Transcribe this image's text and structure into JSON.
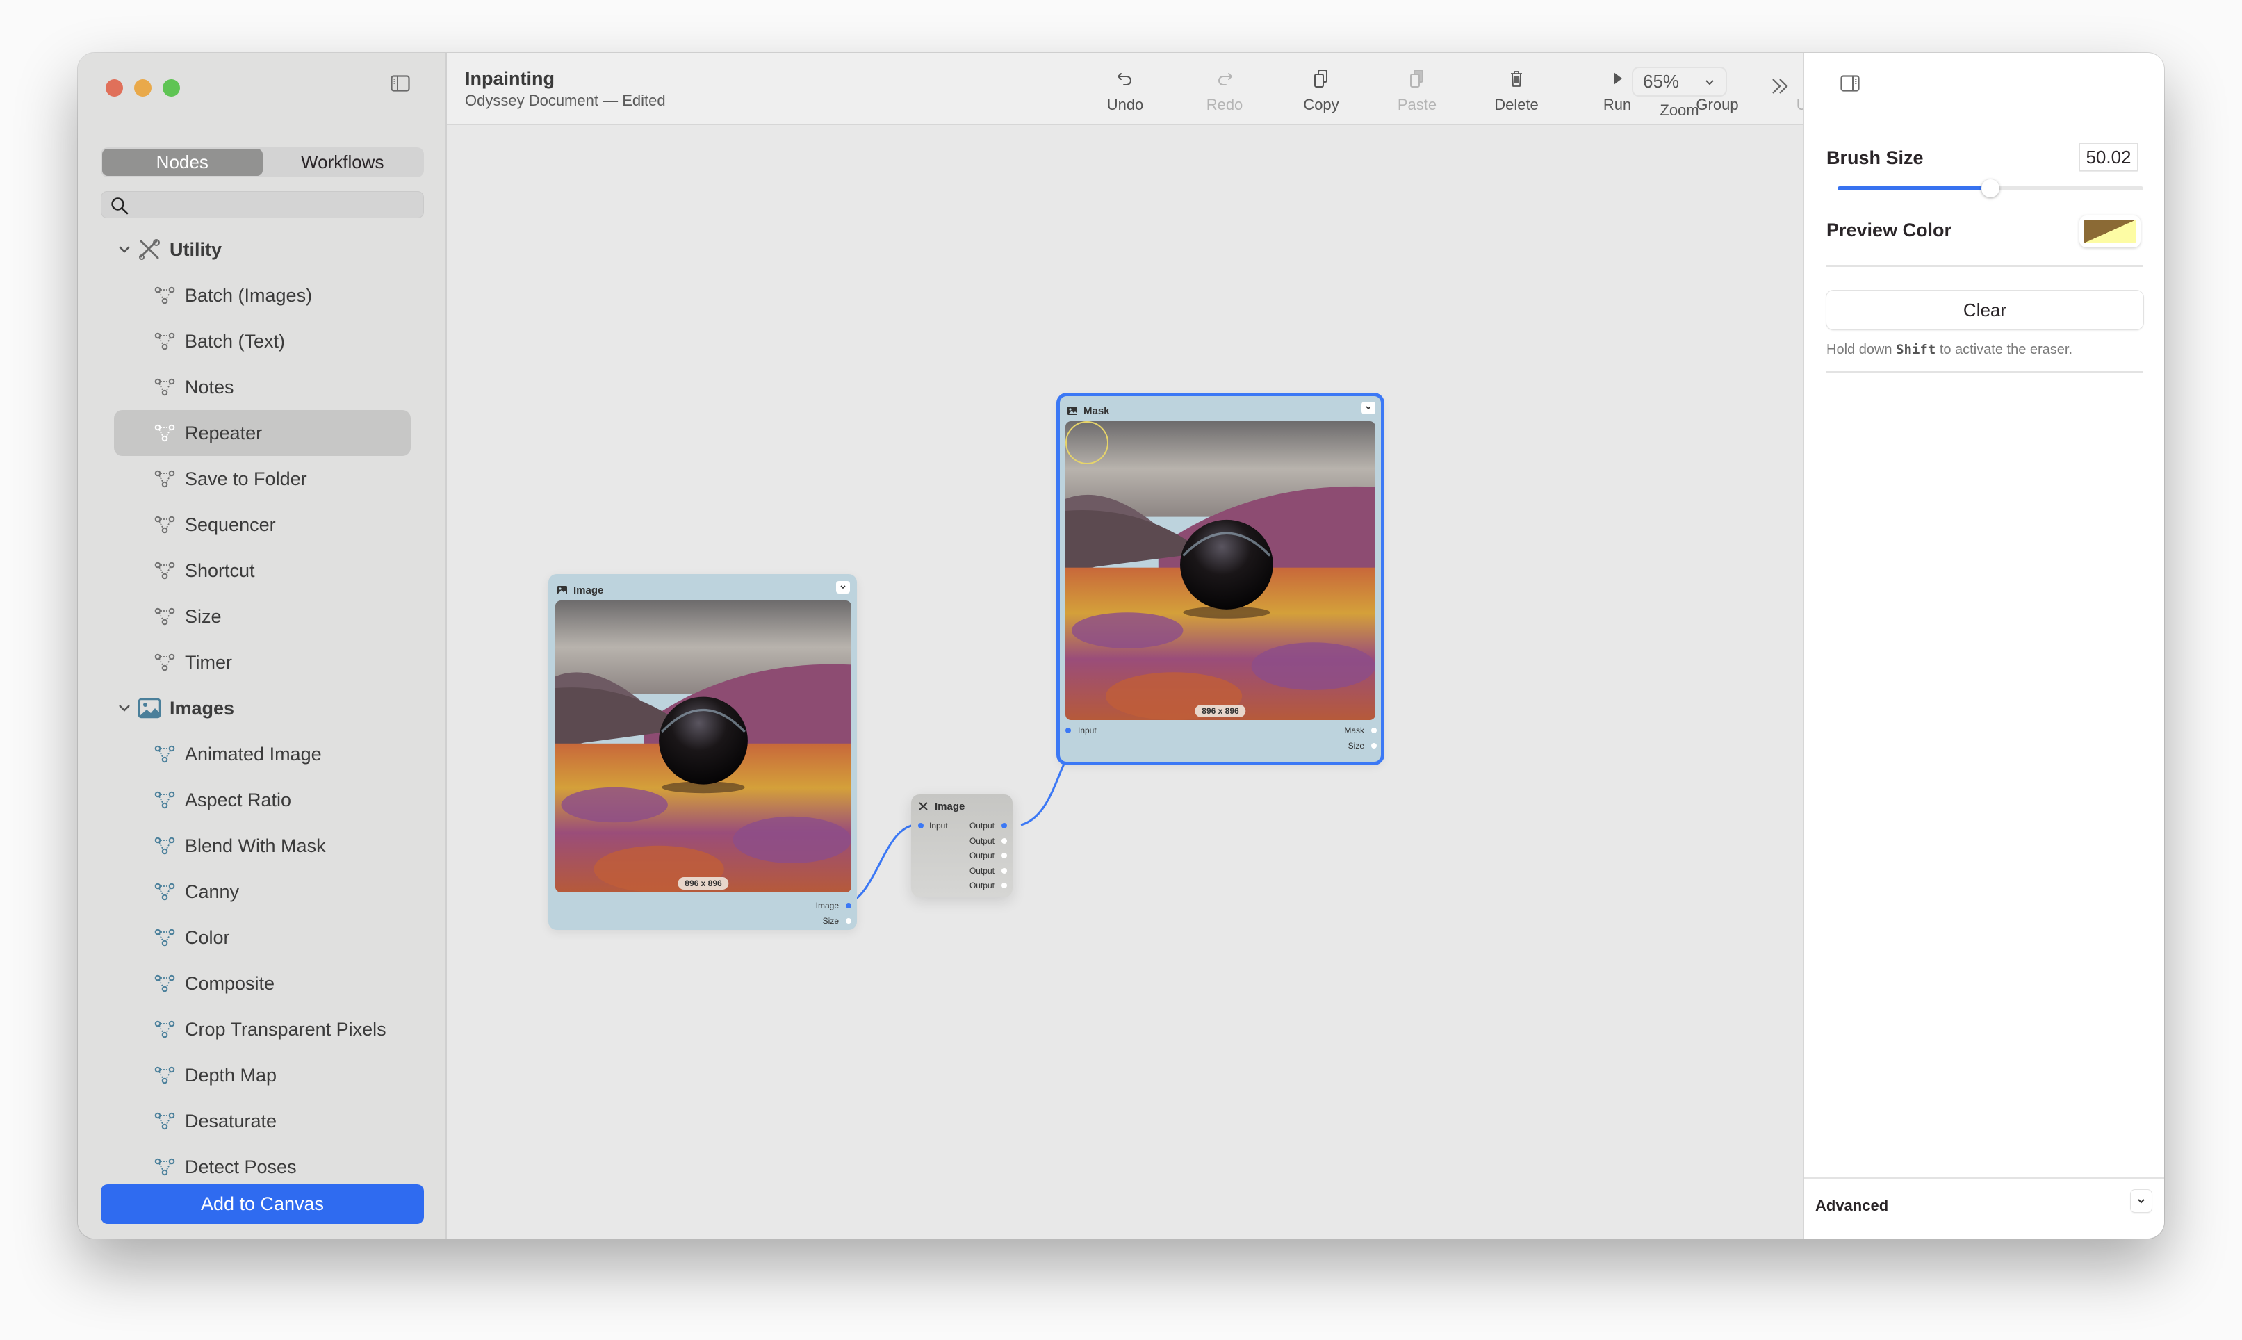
{
  "window": {
    "title": "Inpainting",
    "subtitle": "Odyssey Document — Edited"
  },
  "sidebar": {
    "tabs": [
      {
        "label": "Nodes",
        "active": true
      },
      {
        "label": "Workflows",
        "active": false
      }
    ],
    "search": {
      "value": "",
      "placeholder": ""
    },
    "groups": [
      {
        "label": "Utility",
        "icon": "wrench-screwdriver-icon",
        "expanded": true,
        "items": [
          "Batch (Images)",
          "Batch (Text)",
          "Notes",
          "Repeater",
          "Save to Folder",
          "Sequencer",
          "Shortcut",
          "Size",
          "Timer"
        ]
      },
      {
        "label": "Images",
        "icon": "photo-icon",
        "expanded": true,
        "items": [
          "Animated Image",
          "Aspect Ratio",
          "Blend With Mask",
          "Canny",
          "Color",
          "Composite",
          "Crop Transparent Pixels",
          "Depth Map",
          "Desaturate",
          "Detect Poses"
        ]
      }
    ],
    "selected_item": "Repeater",
    "add_button": "Add to Canvas"
  },
  "toolbar": {
    "buttons": [
      {
        "label": "Undo",
        "icon": "undo-icon",
        "enabled": true
      },
      {
        "label": "Redo",
        "icon": "redo-icon",
        "enabled": false
      },
      {
        "label": "Copy",
        "icon": "copy-icon",
        "enabled": true
      },
      {
        "label": "Paste",
        "icon": "paste-icon",
        "enabled": false
      },
      {
        "label": "Delete",
        "icon": "trash-icon",
        "enabled": true
      },
      {
        "label": "Run",
        "icon": "play-icon",
        "enabled": true
      },
      {
        "label": "Group",
        "icon": "group-icon",
        "enabled": true
      },
      {
        "label": "Ungroup",
        "icon": "ungroup-icon",
        "enabled": false
      }
    ],
    "zoom": {
      "value": "65%",
      "label": "Zoom"
    }
  },
  "canvas": {
    "nodes": [
      {
        "title": "Image",
        "kind": "image",
        "dimensions": "896 x 896",
        "outputs": [
          {
            "label": "Image",
            "connected": true
          },
          {
            "label": "Size",
            "connected": false
          }
        ]
      },
      {
        "title": "Image",
        "kind": "utility",
        "inputs": [
          {
            "label": "Input",
            "connected": true
          }
        ],
        "outputs": [
          {
            "label": "Output",
            "connected": true
          },
          {
            "label": "Output",
            "connected": false
          },
          {
            "label": "Output",
            "connected": false
          },
          {
            "label": "Output",
            "connected": false
          },
          {
            "label": "Output",
            "connected": false
          }
        ]
      },
      {
        "title": "Mask",
        "kind": "image",
        "selected": true,
        "dimensions": "896 x 896",
        "inputs": [
          {
            "label": "Input",
            "connected": true
          }
        ],
        "outputs": [
          {
            "label": "Mask",
            "connected": false
          },
          {
            "label": "Size",
            "connected": false
          }
        ]
      }
    ]
  },
  "inspector": {
    "brush_size": {
      "label": "Brush Size",
      "value": "50.02",
      "fraction": 0.5
    },
    "preview_color": {
      "label": "Preview Color",
      "color_a": "#8b6a35",
      "color_b": "#fdfca4"
    },
    "clear_label": "Clear",
    "hint_pre": "Hold down ",
    "hint_key": "Shift",
    "hint_post": " to activate the eraser.",
    "advanced_label": "Advanced"
  },
  "colors": {
    "accent": "#2f6bf0",
    "node_image_bg": "#bdd3dd",
    "selection": "#3b78f5"
  }
}
